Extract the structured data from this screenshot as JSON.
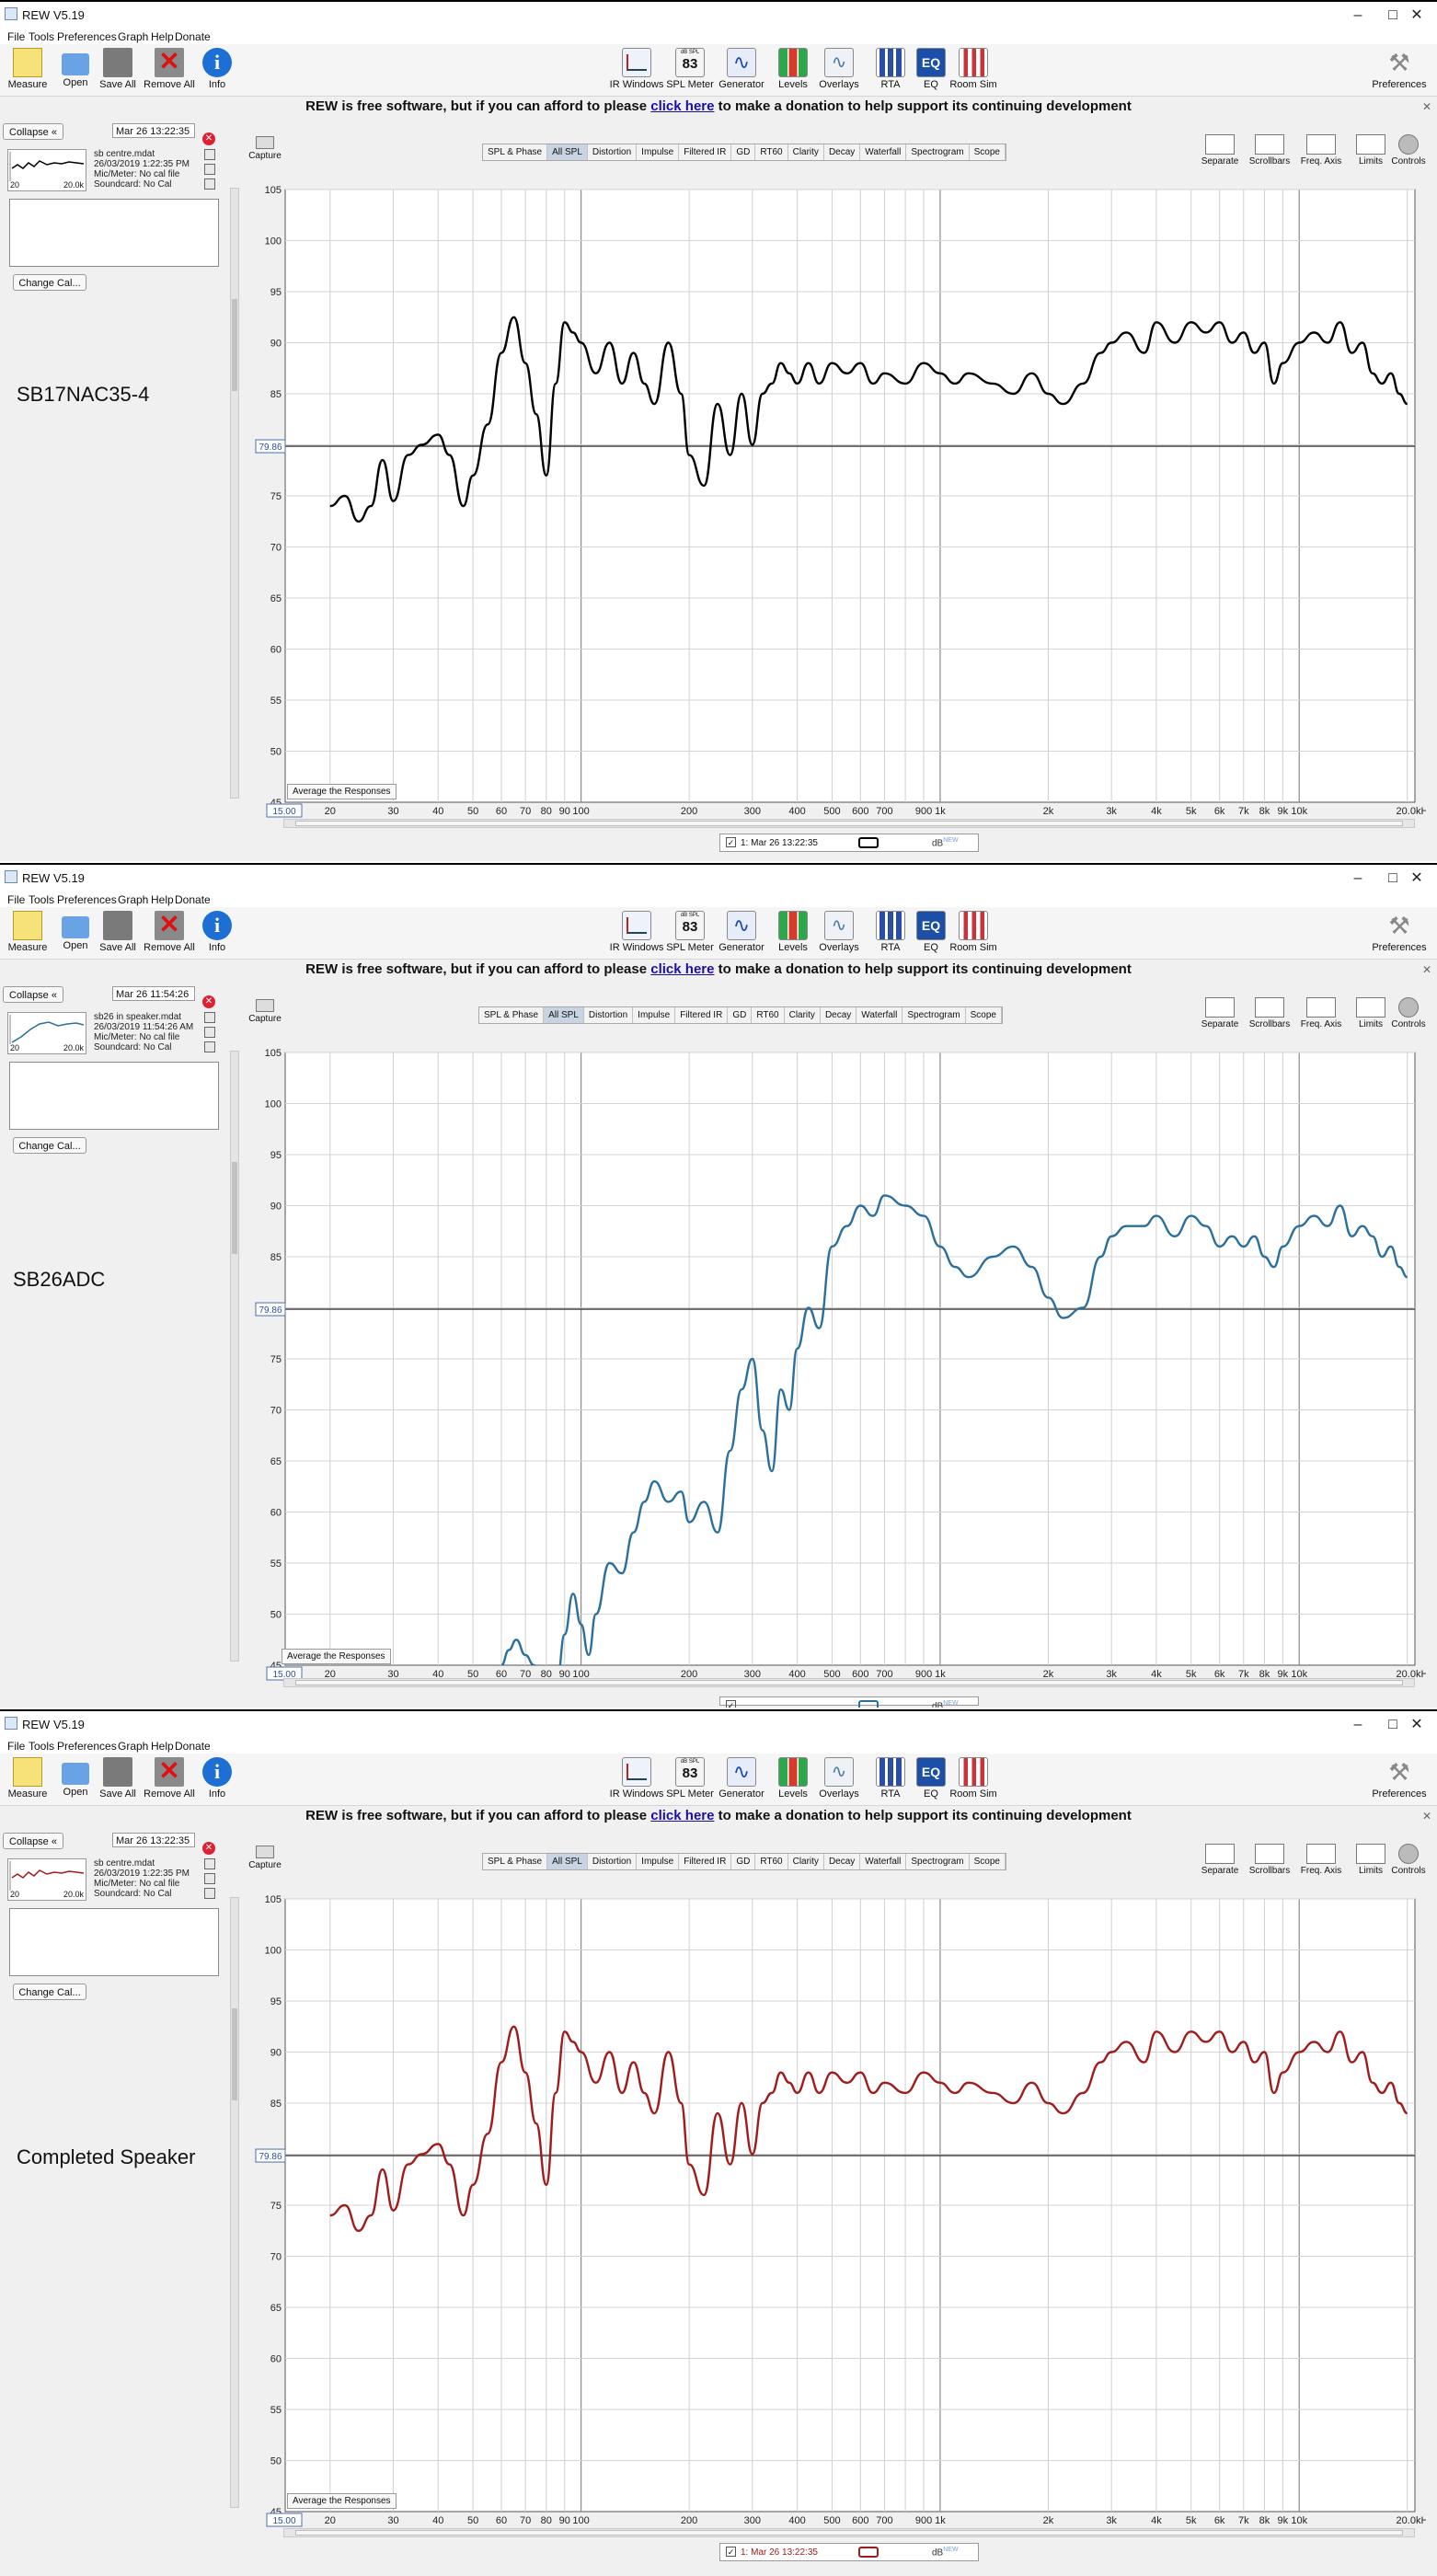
{
  "app": {
    "title": "REW V5.19",
    "menu": [
      "File",
      "Tools",
      "Preferences",
      "Graph",
      "Help",
      "Donate"
    ],
    "toolbar_left": [
      "Measure",
      "Open",
      "Save All",
      "Remove All",
      "Info"
    ],
    "toolbar_center": [
      "IR Windows",
      "SPL Meter",
      "Generator",
      "Levels",
      "Overlays",
      "RTA",
      "EQ",
      "Room Sim"
    ],
    "toolbar_right": "Preferences",
    "spl_meter_reading": "83",
    "spl_meter_unit": "dB SPL",
    "eq_icon_text": "EQ",
    "donate_before": "REW is free software, but if you can afford to please",
    "donate_link": "click here",
    "donate_after": "to make a donation to help support its continuing development",
    "collapse_label": "Collapse",
    "change_cal_label": "Change Cal...",
    "capture_label": "Capture",
    "average_label": "Average the Responses",
    "graph_tabs": [
      "SPL & Phase",
      "All SPL",
      "Distortion",
      "Impulse",
      "Filtered IR",
      "GD",
      "RT60",
      "Clarity",
      "Decay",
      "Waterfall",
      "Spectrogram",
      "Scope"
    ],
    "active_tab": "All SPL",
    "right_buttons": [
      "Separate",
      "Scrollbars",
      "Freq. Axis",
      "Limits",
      "Controls"
    ],
    "db_label": "dB",
    "db_superscript": "NEW"
  },
  "colors": {
    "series_1": "#000000",
    "series_2": "#2b6f9c",
    "series_3": "#a01c1c"
  },
  "windows": [
    {
      "label": "SB17NAC35-4",
      "meas_date": "Mar 26 13:22:35",
      "meas_name": "sb centre.mdat",
      "meas_datetime": "26/03/2019 1:22:35 PM",
      "mic": "Mic/Meter: No cal file",
      "soundcard": "Soundcard: No Cal",
      "thumb_left": "20",
      "thumb_right": "20.0k",
      "status_name": "1: Mar 26 13:22:35",
      "color": "#000000"
    },
    {
      "label": "SB26ADC",
      "meas_date": "Mar 26 11:54:26",
      "meas_name": "sb26 in speaker.mdat",
      "meas_datetime": "26/03/2019 11:54:26 AM",
      "mic": "Mic/Meter: No cal file",
      "soundcard": "Soundcard: No Cal",
      "thumb_left": "20",
      "thumb_right": "20.0k",
      "status_name": "",
      "color": "#2b6f9c"
    },
    {
      "label": "Completed Speaker",
      "meas_date": "Mar 26 13:22:35",
      "meas_name": "sb centre.mdat",
      "meas_datetime": "26/03/2019 1:22:35 PM",
      "mic": "Mic/Meter: No cal file",
      "soundcard": "Soundcard: No Cal",
      "thumb_left": "20",
      "thumb_right": "20.0k",
      "status_name": "1: Mar 26 13:22:35",
      "color": "#a01c1c"
    }
  ],
  "chart_data": [
    {
      "type": "line",
      "x_scale": "log",
      "xlim": [
        15,
        21000
      ],
      "ylim": [
        45,
        105
      ],
      "ylabel": "",
      "xlabel": "",
      "y_ticks": [
        50,
        55,
        60,
        65,
        70,
        75,
        80,
        85,
        90,
        95,
        100,
        105
      ],
      "y_ticks_printed": [
        "45",
        "50",
        "55",
        "60",
        "65",
        "70",
        "75",
        "80",
        "85",
        "90",
        "95",
        "100",
        "105"
      ],
      "x_ticks": [
        20,
        30,
        40,
        50,
        60,
        70,
        80,
        90,
        100,
        200,
        300,
        400,
        500,
        600,
        700,
        900,
        1000,
        2000,
        3000,
        4000,
        5000,
        6000,
        7000,
        8000,
        9000,
        10000,
        20000
      ],
      "x_tick_labels": [
        "20",
        "30",
        "40",
        "50",
        "60",
        "70",
        "80",
        "90",
        "100",
        "200",
        "300",
        "400",
        "500",
        "600",
        "700",
        "900",
        "1k",
        "2k",
        "3k",
        "4k",
        "5k",
        "6k",
        "7k",
        "8k",
        "9k",
        "10k",
        "20.0kHz"
      ],
      "x_left_label": "15.00",
      "reference_level": 79.86,
      "reference_label": "79.86",
      "grid": true,
      "series": [
        {
          "x": [
            20,
            22,
            24,
            26,
            28,
            30,
            33,
            36,
            40,
            43,
            47,
            50,
            55,
            60,
            65,
            70,
            75,
            80,
            85,
            90,
            95,
            100,
            110,
            120,
            130,
            140,
            150,
            160,
            175,
            190,
            200,
            220,
            240,
            260,
            280,
            300,
            320,
            340,
            360,
            380,
            400,
            430,
            460,
            500,
            550,
            600,
            650,
            700,
            800,
            900,
            1000,
            1100,
            1200,
            1400,
            1600,
            1800,
            2000,
            2200,
            2500,
            2800,
            3000,
            3300,
            3700,
            4000,
            4500,
            5000,
            5500,
            6000,
            6500,
            7000,
            7500,
            8000,
            8500,
            9000,
            10000,
            11000,
            12000,
            13000,
            14000,
            15000,
            16000,
            17000,
            18000,
            19000,
            20000
          ],
          "y": [
            74,
            75,
            72.5,
            74,
            78.5,
            74.5,
            79,
            80,
            81,
            79,
            74,
            77,
            82,
            89,
            92.5,
            88,
            83,
            77,
            86,
            92,
            91,
            90,
            87,
            90,
            86,
            89,
            86,
            84,
            90,
            85,
            79,
            76,
            84,
            79,
            85,
            80,
            85,
            86,
            88,
            87,
            86,
            88,
            86,
            88,
            87,
            88,
            86,
            87,
            86,
            88,
            87,
            86,
            87,
            86,
            85,
            87,
            85,
            84,
            86,
            89,
            90,
            91,
            89,
            92,
            90,
            92,
            91,
            92,
            90,
            91,
            89,
            90,
            86,
            88,
            90,
            91,
            90,
            92,
            89,
            90,
            87,
            86,
            87,
            85,
            84
          ]
        }
      ]
    },
    {
      "type": "line",
      "x_scale": "log",
      "xlim": [
        15,
        21000
      ],
      "ylim": [
        45,
        105
      ],
      "ylabel": "",
      "xlabel": "",
      "y_ticks": [
        50,
        55,
        60,
        65,
        70,
        75,
        80,
        85,
        90,
        95,
        100,
        105
      ],
      "y_ticks_printed": [
        "45",
        "50",
        "55",
        "60",
        "65",
        "70",
        "75",
        "80",
        "85",
        "90",
        "95",
        "100",
        "105"
      ],
      "x_ticks": [
        20,
        30,
        40,
        50,
        60,
        70,
        80,
        90,
        100,
        200,
        300,
        400,
        500,
        600,
        700,
        900,
        1000,
        2000,
        3000,
        4000,
        5000,
        6000,
        7000,
        8000,
        9000,
        10000,
        20000
      ],
      "x_tick_labels": [
        "20",
        "30",
        "40",
        "50",
        "60",
        "70",
        "80",
        "90",
        "100",
        "200",
        "300",
        "400",
        "500",
        "600",
        "700",
        "900",
        "1k",
        "2k",
        "3k",
        "4k",
        "5k",
        "6k",
        "7k",
        "8k",
        "9k",
        "10k",
        "20.0kHz"
      ],
      "x_left_label": "15.00",
      "reference_level": 79.86,
      "reference_label": "79.86",
      "grid": true,
      "series": [
        {
          "x": [
            60,
            63,
            66,
            70,
            74,
            78,
            82,
            86,
            90,
            95,
            100,
            105,
            110,
            120,
            130,
            140,
            150,
            160,
            175,
            190,
            200,
            220,
            240,
            260,
            280,
            300,
            320,
            340,
            360,
            380,
            400,
            430,
            460,
            500,
            550,
            600,
            650,
            700,
            800,
            900,
            1000,
            1100,
            1200,
            1400,
            1600,
            1800,
            2000,
            2200,
            2500,
            2800,
            3000,
            3300,
            3700,
            4000,
            4500,
            5000,
            5500,
            6000,
            6500,
            7000,
            7500,
            8000,
            8500,
            9000,
            10000,
            11000,
            12000,
            13000,
            14000,
            15000,
            16000,
            17000,
            18000,
            19000,
            20000
          ],
          "y": [
            45,
            46.5,
            47.5,
            46,
            45,
            43,
            42,
            44,
            48,
            52,
            49,
            46,
            50,
            55,
            54,
            58,
            61,
            63,
            61,
            62,
            59,
            61,
            58,
            66,
            72,
            75,
            68,
            64,
            72,
            70,
            76,
            80,
            78,
            86,
            88,
            90,
            89,
            91,
            90,
            89,
            86,
            84,
            83,
            85,
            86,
            84,
            81,
            79,
            80,
            85,
            87,
            88,
            88,
            89,
            87,
            89,
            88,
            86,
            87,
            86,
            87,
            85,
            84,
            86,
            88,
            89,
            88,
            90,
            87,
            88,
            87,
            85,
            86,
            84,
            83
          ]
        }
      ]
    },
    {
      "type": "line",
      "x_scale": "log",
      "xlim": [
        15,
        21000
      ],
      "ylim": [
        45,
        105
      ],
      "ylabel": "",
      "xlabel": "",
      "y_ticks": [
        50,
        55,
        60,
        65,
        70,
        75,
        80,
        85,
        90,
        95,
        100,
        105
      ],
      "y_ticks_printed": [
        "45",
        "50",
        "55",
        "60",
        "65",
        "70",
        "75",
        "80",
        "85",
        "90",
        "95",
        "100",
        "105"
      ],
      "x_ticks": [
        20,
        30,
        40,
        50,
        60,
        70,
        80,
        90,
        100,
        200,
        300,
        400,
        500,
        600,
        700,
        900,
        1000,
        2000,
        3000,
        4000,
        5000,
        6000,
        7000,
        8000,
        9000,
        10000,
        20000
      ],
      "x_tick_labels": [
        "20",
        "30",
        "40",
        "50",
        "60",
        "70",
        "80",
        "90",
        "100",
        "200",
        "300",
        "400",
        "500",
        "600",
        "700",
        "900",
        "1k",
        "2k",
        "3k",
        "4k",
        "5k",
        "6k",
        "7k",
        "8k",
        "9k",
        "10k",
        "20.0kHz"
      ],
      "x_left_label": "15.00",
      "reference_level": 79.86,
      "reference_label": "79.86",
      "grid": true,
      "series": [
        {
          "x": [
            20,
            22,
            24,
            26,
            28,
            30,
            33,
            36,
            40,
            43,
            47,
            50,
            55,
            60,
            65,
            70,
            75,
            80,
            85,
            90,
            95,
            100,
            110,
            120,
            130,
            140,
            150,
            160,
            175,
            190,
            200,
            220,
            240,
            260,
            280,
            300,
            320,
            340,
            360,
            380,
            400,
            430,
            460,
            500,
            550,
            600,
            650,
            700,
            800,
            900,
            1000,
            1100,
            1200,
            1400,
            1600,
            1800,
            2000,
            2200,
            2500,
            2800,
            3000,
            3300,
            3700,
            4000,
            4500,
            5000,
            5500,
            6000,
            6500,
            7000,
            7500,
            8000,
            8500,
            9000,
            10000,
            11000,
            12000,
            13000,
            14000,
            15000,
            16000,
            17000,
            18000,
            19000,
            20000
          ],
          "y": [
            74,
            75,
            72.5,
            74,
            78.5,
            74.5,
            79,
            80,
            81,
            79,
            74,
            77,
            82,
            89,
            92.5,
            88,
            83,
            77,
            86,
            92,
            91,
            90,
            87,
            90,
            86,
            89,
            86,
            84,
            90,
            85,
            79,
            76,
            84,
            79,
            85,
            80,
            85,
            86,
            88,
            87,
            86,
            88,
            86,
            88,
            87,
            88,
            86,
            87,
            86,
            88,
            87,
            86,
            87,
            86,
            85,
            87,
            85,
            84,
            86,
            89,
            90,
            91,
            89,
            92,
            90,
            92,
            91,
            92,
            90,
            91,
            89,
            90,
            86,
            88,
            90,
            91,
            90,
            92,
            89,
            90,
            87,
            86,
            87,
            85,
            84
          ]
        }
      ]
    }
  ]
}
